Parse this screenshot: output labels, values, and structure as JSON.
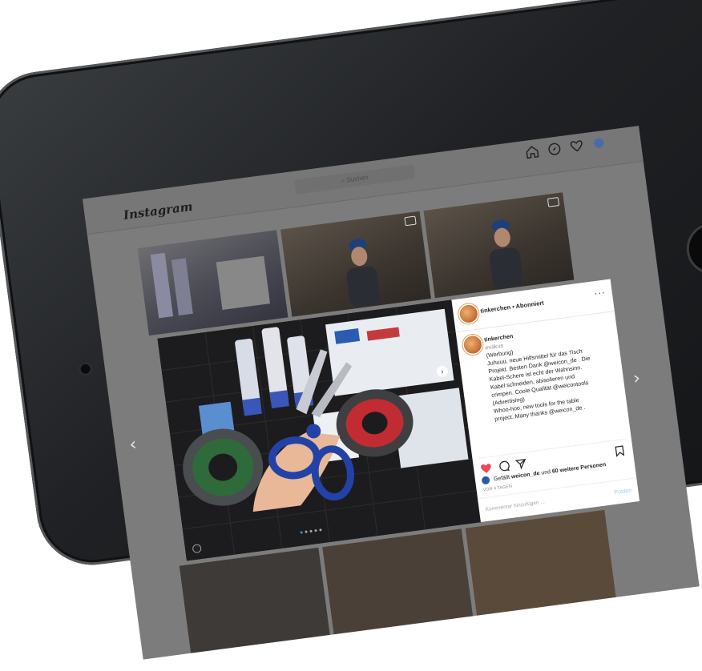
{
  "instagram": {
    "logo": "Instagram",
    "search_placeholder": "Suchen",
    "nav_icons": [
      "home-icon",
      "explore-icon",
      "heart-icon",
      "profile-avatar"
    ]
  },
  "post": {
    "header_user": "tinkerchen • Abonniert",
    "caption": {
      "username": "tinkerchen",
      "location": "evakus",
      "lines": [
        "(Werbung)",
        "Juhuuu, neue Hilfsmittel für das Tisch",
        "Projekt. Besten Dank @weicon_de . Die",
        "Kabel-Schere ist echt der Wahnsinn.",
        "Kabel schneiden, abisolieren und",
        "crimpen. Coole Qualität @weicontools",
        "(Advertising)",
        "Whoo-hoo, new tools for the table",
        "project. Many thanks @weicon_de ."
      ]
    },
    "likes_prefix": "Gefällt",
    "likes_user": "weicon_de",
    "likes_middle": "und",
    "likes_others": "60 weitere Personen",
    "date": "VOR 4 TAGEN",
    "comment_placeholder": "Kommentar hinzufügen ...",
    "post_button": "Posten"
  },
  "icons": {
    "like": "heart-filled-icon",
    "comment": "comment-icon",
    "share": "send-icon",
    "save": "bookmark-icon",
    "more": "more-icon",
    "video": "video-icon"
  },
  "colors": {
    "like_red": "#ed4956",
    "mention_blue": "#00376b",
    "post_button_blue": "#9cc8f0",
    "overlay_gray": "#7c7c7c"
  }
}
